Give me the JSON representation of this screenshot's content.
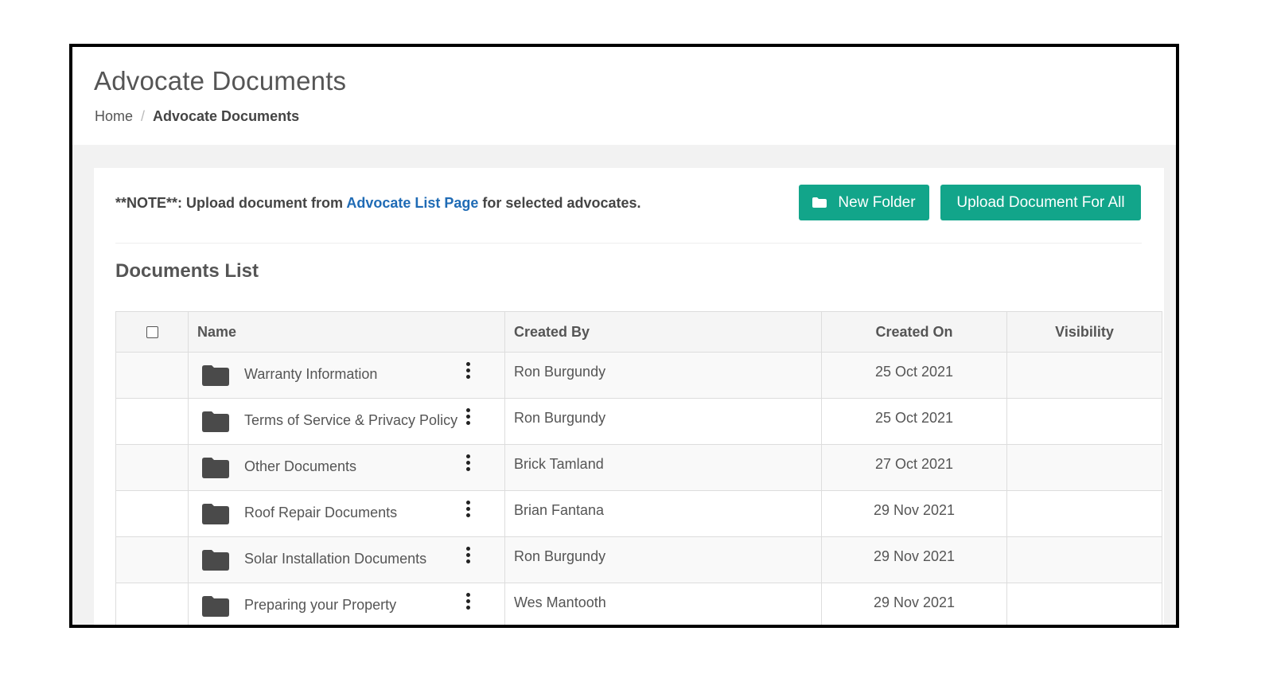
{
  "header": {
    "title": "Advocate Documents",
    "breadcrumb": {
      "home": "Home",
      "separator": "/",
      "current": "Advocate Documents"
    }
  },
  "note": {
    "prefix": "**NOTE**: Upload document from ",
    "link": "Advocate List Page",
    "suffix": " for selected advocates."
  },
  "actions": {
    "new_folder_label": "New Folder",
    "upload_all_label": "Upload Document For All",
    "accent_color": "#12a58a"
  },
  "documents": {
    "section_title": "Documents List",
    "columns": {
      "name": "Name",
      "created_by": "Created By",
      "created_on": "Created On",
      "visibility": "Visibility"
    },
    "rows": [
      {
        "name": "Warranty Information",
        "created_by": "Ron Burgundy",
        "created_on": "25 Oct 2021",
        "visibility": ""
      },
      {
        "name": "Terms of Service & Privacy Policy",
        "created_by": "Ron Burgundy",
        "created_on": "25 Oct 2021",
        "visibility": ""
      },
      {
        "name": "Other Documents",
        "created_by": "Brick Tamland",
        "created_on": "27 Oct 2021",
        "visibility": ""
      },
      {
        "name": "Roof Repair Documents",
        "created_by": "Brian Fantana",
        "created_on": "29 Nov 2021",
        "visibility": ""
      },
      {
        "name": "Solar Installation Documents",
        "created_by": "Ron Burgundy",
        "created_on": "29 Nov 2021",
        "visibility": ""
      },
      {
        "name": "Preparing your Property",
        "created_by": "Wes Mantooth",
        "created_on": "29 Nov 2021",
        "visibility": ""
      }
    ]
  },
  "icons": {
    "row_icon": "folder-icon",
    "row_menu": "kebab-menu-icon",
    "button_icon": "folder-icon"
  }
}
